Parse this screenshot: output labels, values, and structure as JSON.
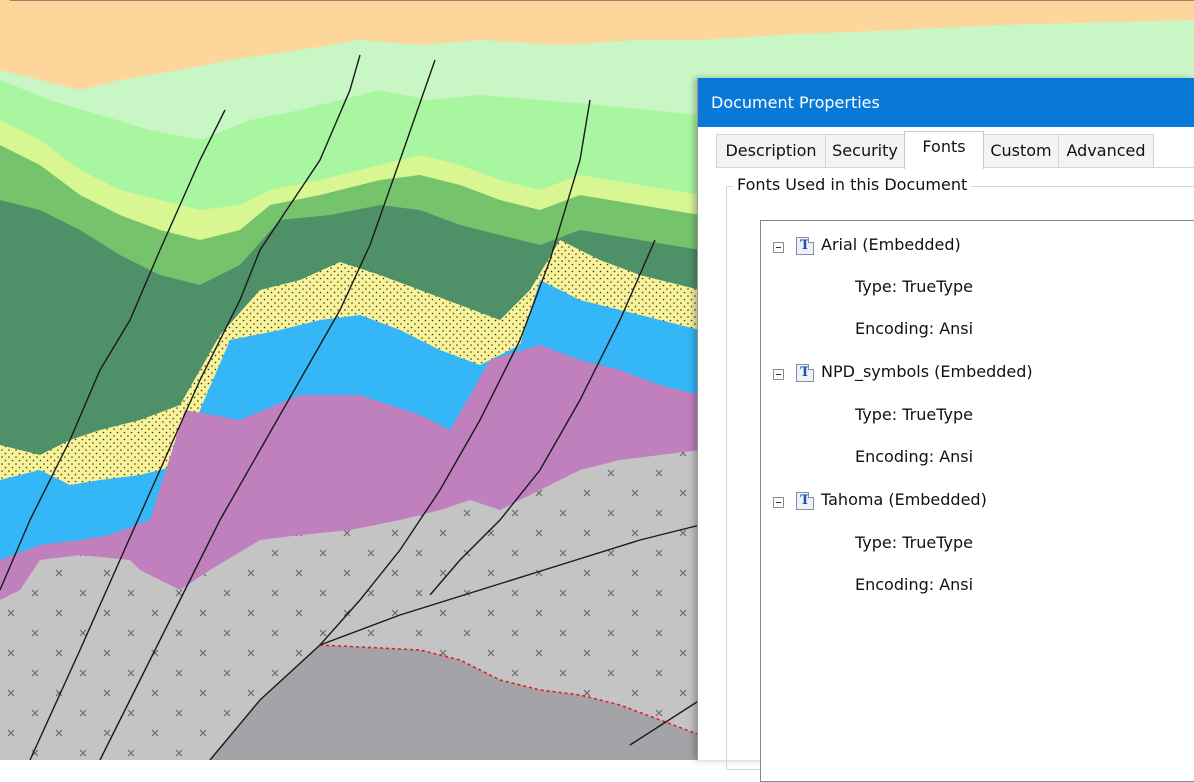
{
  "dialog": {
    "title": "Document Properties",
    "tabs": [
      {
        "label": "Description"
      },
      {
        "label": "Security"
      },
      {
        "label": "Fonts",
        "active": true
      },
      {
        "label": "Custom"
      },
      {
        "label": "Advanced"
      }
    ],
    "group_label": "Fonts Used in this Document",
    "fonts": [
      {
        "name": "Arial (Embedded)",
        "type": "Type: TrueType",
        "encoding": "Encoding: Ansi"
      },
      {
        "name": "NPD_symbols (Embedded)",
        "type": "Type: TrueType",
        "encoding": "Encoding: Ansi"
      },
      {
        "name": "Tahoma (Embedded)",
        "type": "Type: TrueType",
        "encoding": "Encoding: Ansi"
      }
    ]
  },
  "colors": {
    "titlebar": "#0a78d7",
    "sand_peach": "#fdd69c",
    "light_green": "#c8f7c5",
    "green": "#a8f6a0",
    "yellow_green": "#d8f792",
    "mid_green": "#75c46c",
    "dark_green": "#4e9068",
    "sandstone": "#f8f299",
    "blue": "#35b6f6",
    "purple": "#c07fbd",
    "basement_grey": "#c4c4c4",
    "dark_grey": "#a3a3a8"
  }
}
